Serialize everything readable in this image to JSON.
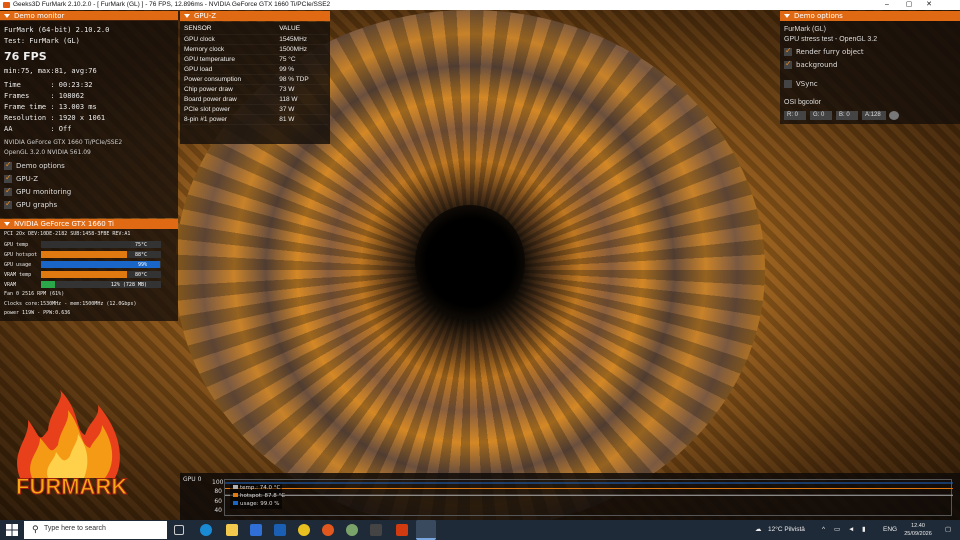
{
  "window": {
    "title": "Geeks3D FurMark 2.10.2.0 - [ FurMark (GL) ] - 76 FPS, 12.896ms - NVIDIA GeForce GTX 1660 Ti/PCIe/SSE2"
  },
  "demo_monitor": {
    "header": "Demo monitor",
    "line1": "FurMark (64-bit) 2.10.2.0",
    "line2": "Test: FurMark (GL)",
    "fps": "76 FPS",
    "fps_stats": "min:75, max:81, avg:76",
    "time": "Time       : 00:23:32",
    "frames": "Frames     : 108062",
    "frame_time": "Frame time : 13.003 ms",
    "resolution": "Resolution : 1920 x 1061",
    "aa": "AA         : Off",
    "gpu_name": "NVIDIA GeForce GTX 1660 Ti/PCIe/SSE2",
    "gl": "OpenGL 3.2.0 NVIDIA 561.09",
    "checks": [
      {
        "label": "Demo options"
      },
      {
        "label": "GPU-Z"
      },
      {
        "label": "GPU monitoring"
      },
      {
        "label": "GPU graphs"
      }
    ]
  },
  "gpu_monitor": {
    "header": "NVIDIA GeForce GTX 1660 Ti",
    "pci": "PCI 2Ox     DEV:10DE-2182 SUB:1458-3FBE REV:A1",
    "rows": [
      {
        "label": "GPU temp",
        "value": "75°C",
        "fraction": 0.75,
        "color": "#303030"
      },
      {
        "label": "GPU hotspot",
        "value": "88°C",
        "fraction": 0.72,
        "color": "#e07a10"
      },
      {
        "label": "GPU usage",
        "value": "99%",
        "fraction": 0.99,
        "color": "#1a66c8"
      },
      {
        "label": "VRAM temp",
        "value": "80°C",
        "fraction": 0.72,
        "color": "#e07a10"
      },
      {
        "label": "VRAM",
        "value": "12% (728 MB)",
        "fraction": 0.12,
        "color": "#2aa84a"
      }
    ],
    "fan": "Fan 0       2516 RPM (61%)",
    "clocks": "Clocks      core:1530MHz - mem:1500MHz (12.0Gbps)",
    "power": "power       119W - PPW:0.636"
  },
  "gpuz": {
    "header": "GPU-Z",
    "col_sensor": "SENSOR",
    "col_value": "VALUE",
    "rows": [
      {
        "sensor": "GPU clock",
        "value": "1545MHz"
      },
      {
        "sensor": "Memory clock",
        "value": "1500MHz"
      },
      {
        "sensor": "GPU temperature",
        "value": "75 °C"
      },
      {
        "sensor": "GPU load",
        "value": "99 %"
      },
      {
        "sensor": "Power consumption",
        "value": "98 % TDP"
      },
      {
        "sensor": "Chip power draw",
        "value": "73 W"
      },
      {
        "sensor": "Board power draw",
        "value": "118 W"
      },
      {
        "sensor": "PCIe slot power",
        "value": "37 W"
      },
      {
        "sensor": "8-pin #1 power",
        "value": "81 W"
      }
    ]
  },
  "demo_options": {
    "header": "Demo options",
    "title": "FurMark (GL)",
    "subtitle": "GPU stress test - OpenGL 3.2",
    "render_furry": "Render furry object",
    "background": "background",
    "vsync": "VSync",
    "bgcolor_label": "OSI bgcolor",
    "r": "R: 0",
    "g": "G: 0",
    "b": "B: 0",
    "a": "A:128"
  },
  "graph": {
    "title": "GPU 0",
    "y_labels": [
      "100",
      "80",
      "60",
      "40"
    ],
    "legend": {
      "temp": "temp.: 74.0 °C",
      "hotspot": "hotspot: 87.8 °C",
      "usage": "usage: 99.0 %"
    },
    "colors": {
      "temp": "#b0b0b0",
      "hotspot": "#e07a10",
      "usage": "#1a66c8"
    },
    "levels": {
      "usage": 99.0,
      "hotspot": 87.8,
      "temp": 74.0
    }
  },
  "logo": {
    "word": "FURMARK"
  },
  "taskbar": {
    "search_placeholder": "Type here to search",
    "weather": "12°C  Pilvistä",
    "lang": "ENG",
    "time": "12.40",
    "date": "25/09/2026"
  }
}
